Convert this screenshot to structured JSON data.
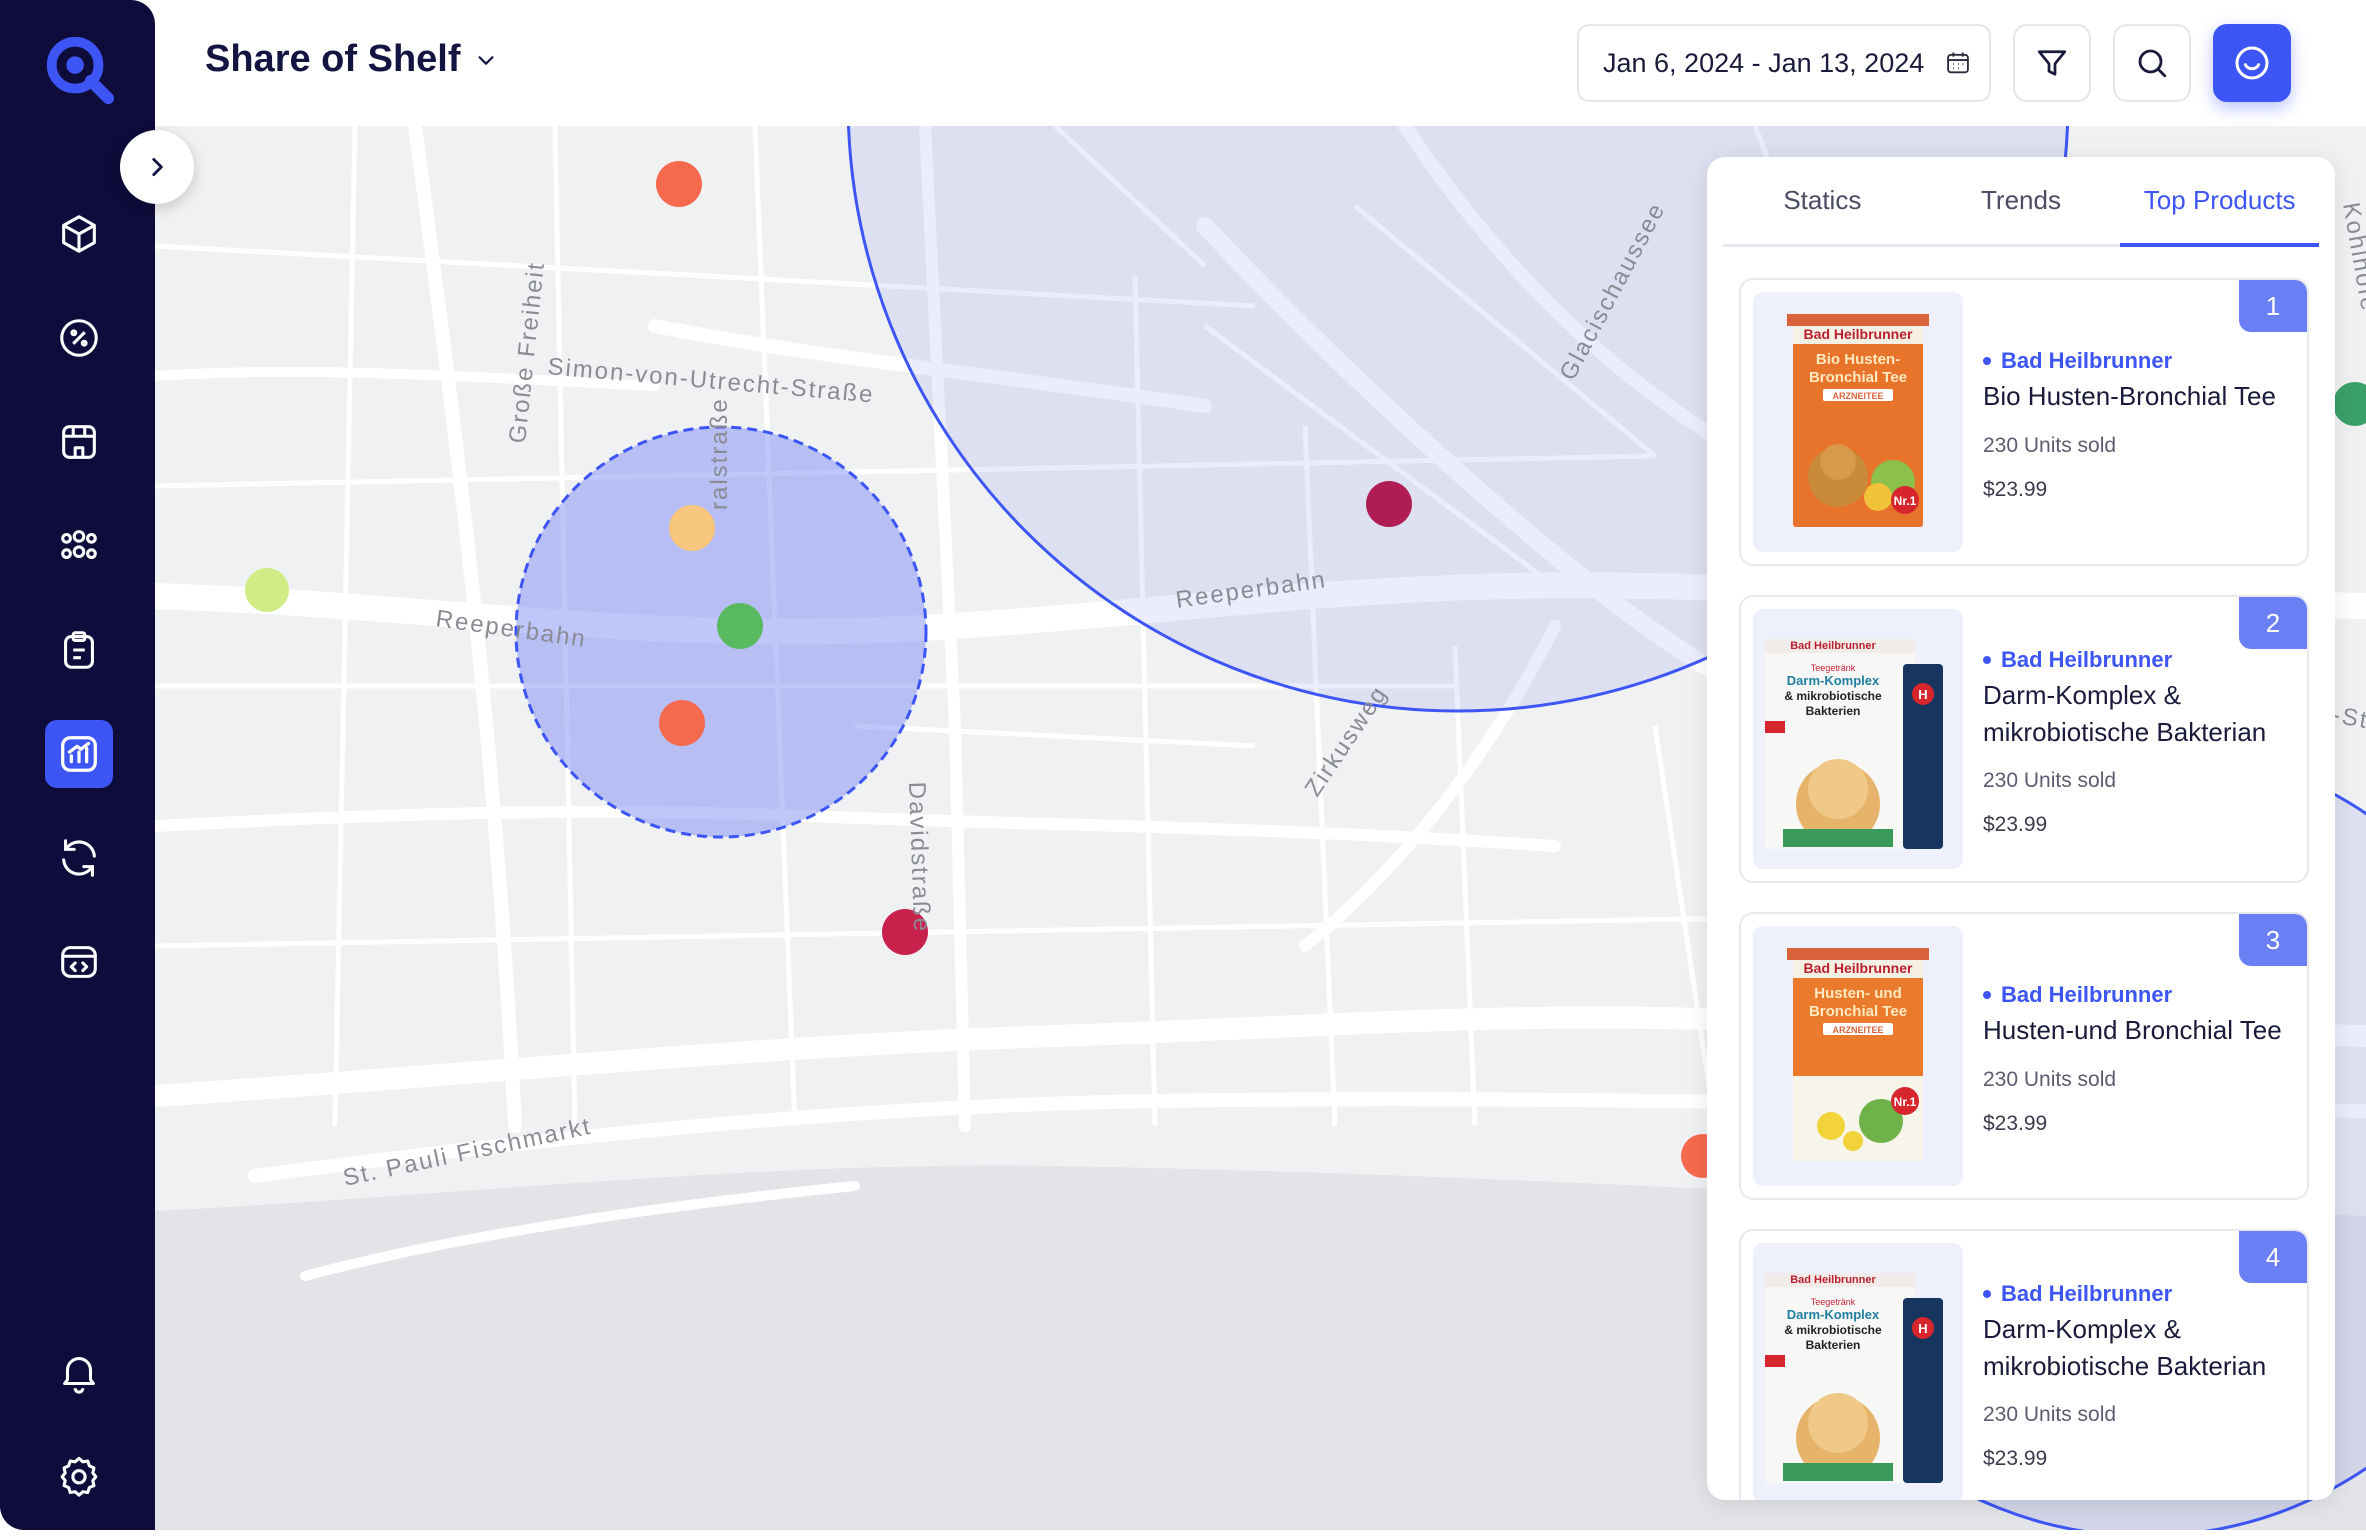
{
  "header": {
    "title": "Share of Shelf",
    "date_range": "Jan 6, 2024 - Jan 13, 2024"
  },
  "sidebar": {
    "items": [
      {
        "name": "products-icon"
      },
      {
        "name": "discount-icon"
      },
      {
        "name": "store-icon"
      },
      {
        "name": "team-icon"
      },
      {
        "name": "clipboard-icon"
      },
      {
        "name": "analytics-icon",
        "active": true
      },
      {
        "name": "refresh-icon"
      },
      {
        "name": "code-icon"
      }
    ],
    "bottom": [
      {
        "name": "bell-icon"
      },
      {
        "name": "settings-icon"
      }
    ]
  },
  "map": {
    "street_labels": [
      "Simon-von-Utrecht-Straße",
      "Große Freiheit",
      "Reeperbahn",
      "Reeperbahn",
      "Davidstraße",
      "Zirkusweg",
      "St. Pauli Fischmarkt",
      "Glacischaussee",
      "Kohlhöfe",
      "ralstraße",
      "-St"
    ]
  },
  "panel": {
    "tabs": [
      "Statics",
      "Trends",
      "Top Products"
    ],
    "active_tab": 2,
    "products": [
      {
        "rank": "1",
        "brand": "Bad Heilbrunner",
        "name": "Bio Husten-Bronchial Tee",
        "units": "230 Units sold",
        "price": "$23.99",
        "pack_title": "Bio Husten-Bronchial Tee",
        "pack_tag": "ARZNEITEE",
        "pack_brand": "Bad Heilbrunner"
      },
      {
        "rank": "2",
        "brand": "Bad Heilbrunner",
        "name": "Darm-Komplex & mikrobiotische Bakterian",
        "units": "230 Units sold",
        "price": "$23.99",
        "pack_title": "Darm-Komplex & mikrobiotische Bakterien",
        "pack_tag": "Teegetränk",
        "pack_brand": "Bad Heilbrunner"
      },
      {
        "rank": "3",
        "brand": "Bad Heilbrunner",
        "name": "Husten-und Bronchial Tee",
        "units": "230 Units sold",
        "price": "$23.99",
        "pack_title": "Husten- und Bronchial Tee",
        "pack_tag": "ARZNEITEE",
        "pack_brand": "Bad Heilbrunner"
      },
      {
        "rank": "4",
        "brand": "Bad Heilbrunner",
        "name": "Darm-Komplex & mikrobiotische Bakterian",
        "units": "230 Units sold",
        "price": "$23.99",
        "pack_title": "Darm-Komplex & mikrobiotische Bakterien",
        "pack_tag": "Teegetränk",
        "pack_brand": "Bad Heilbrunner"
      }
    ]
  },
  "colors": {
    "accent": "#3d55f5",
    "sidebar_bg": "#0d0c3a",
    "rank_badge": "#6b7ff5"
  }
}
